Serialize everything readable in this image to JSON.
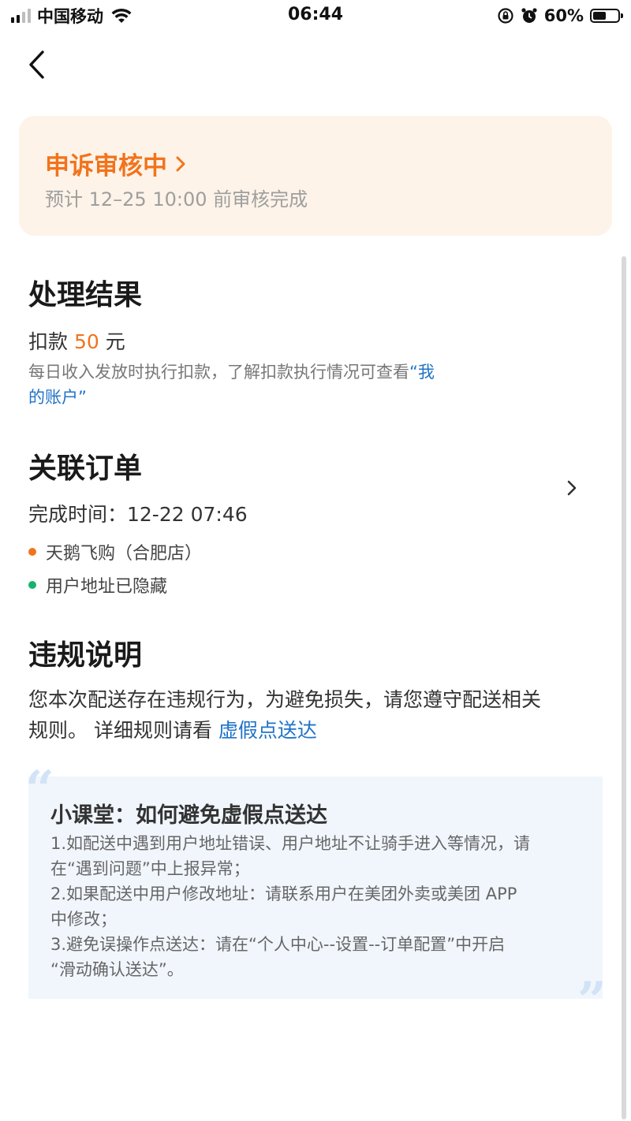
{
  "status_bar": {
    "carrier": "中国移动",
    "time": "06:44",
    "battery_pct": "60%",
    "battery_level": 0.6,
    "icons": [
      "signal-icon",
      "wifi-icon",
      "rotation-lock-icon",
      "alarm-icon",
      "battery-icon"
    ]
  },
  "appeal": {
    "title": "申诉审核中",
    "subtitle": "预计 12–25 10:00 前审核完成"
  },
  "result": {
    "title": "处理结果",
    "deduct_prefix": "扣款 ",
    "deduct_amount": "50",
    "deduct_suffix": " 元",
    "hint_text": "每日收入发放时执行扣款，了解扣款执行情况可查看",
    "hint_link_line1": "“我",
    "hint_link_line2": "的账户”"
  },
  "order": {
    "title": "关联订单",
    "finish_time": "完成时间：12-22 07:46",
    "store": "天鹅飞购（合肥店）",
    "address": "用户地址已隐藏"
  },
  "violation": {
    "title": "违规说明",
    "line1": "您本次配送存在违规行为，为避免损失，请您遵守配送相关",
    "line2_text": "规则。 详细规则请看 ",
    "line2_link": "虚假点送达"
  },
  "tip": {
    "title": "小课堂：如何避免虚假点送达",
    "lines": [
      "1.如配送中遇到用户地址错误、用户地址不让骑手进入等情况，请",
      "在“遇到问题”中上报异常；",
      "2.如果配送中用户修改地址：请联系用户在美团外卖或美团 APP",
      "中修改；",
      "3.避免误操作点送达：请在“个人中心--设置--订单配置”中开启",
      "“滑动确认送达”。"
    ],
    "open_quote": "“",
    "close_quote": "”"
  },
  "colors": {
    "accent": "#f2731c",
    "link": "#1f73c8",
    "card_bg": "#fdf3e8",
    "tip_bg": "#f1f6fd",
    "dot_orange": "#f2731c",
    "dot_green": "#17b36b"
  }
}
